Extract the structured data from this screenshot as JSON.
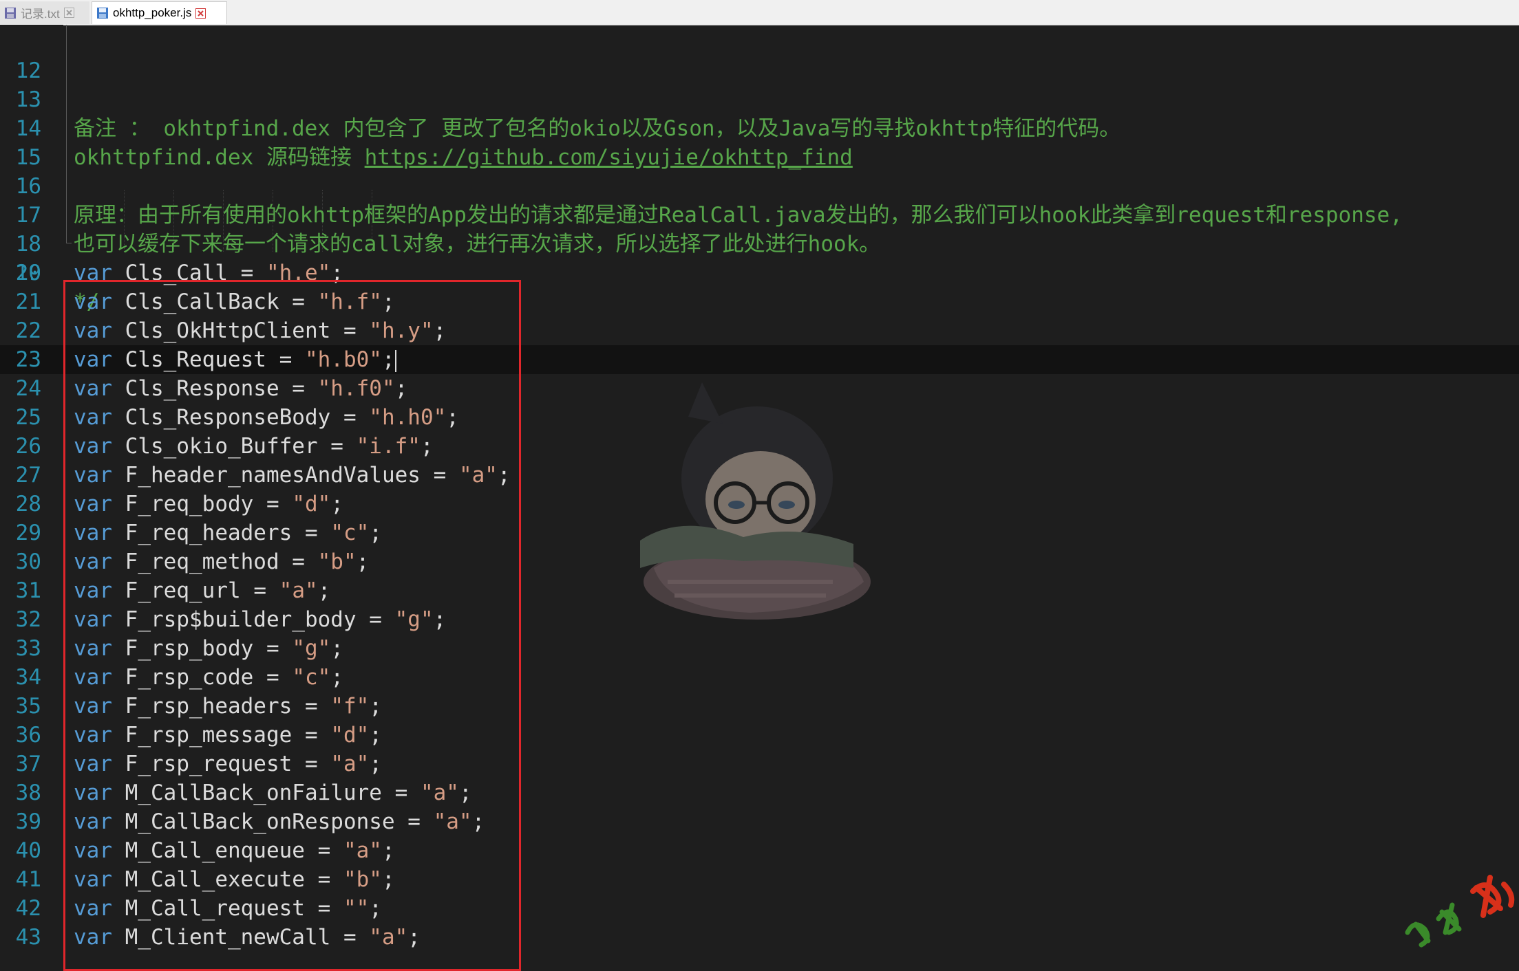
{
  "tabs": [
    {
      "label": "记录.txt",
      "active": false
    },
    {
      "label": "okhttp_poker.js",
      "active": true
    }
  ],
  "colors": {
    "comment": "#57a64a",
    "keyword": "#569cd6",
    "identifier": "#dcdcdc",
    "string": "#d69d85",
    "line_number": "#2b91af",
    "highlight_box": "#e0262b"
  },
  "comment_lines": [
    {
      "num": "12",
      "text": ""
    },
    {
      "num": "13",
      "text": "备注 ： okhtpfind.dex 内包含了 更改了包名的okio以及Gson，以及Java写的寻找okhttp特征的代码。"
    },
    {
      "num": "14",
      "text": "okhttpfind.dex 源码链接 ",
      "url": "https://github.com/siyujie/okhttp_find"
    },
    {
      "num": "15",
      "text": ""
    },
    {
      "num": "16",
      "text": "原理：由于所有使用的okhttp框架的App发出的请求都是通过RealCall.java发出的，那么我们可以hook此类拿到request和response,"
    },
    {
      "num": "17",
      "text": "也可以缓存下来每一个请求的call对象，进行再次请求，所以选择了此处进行hook。"
    },
    {
      "num": "18",
      "text": ""
    },
    {
      "num": "19",
      "text": "*/"
    }
  ],
  "code_lines": [
    {
      "num": "20",
      "kw": "var",
      "name": "Cls_Call",
      "op": " = ",
      "str": "\"h.e\"",
      "end": ";"
    },
    {
      "num": "21",
      "kw": "var",
      "name": "Cls_CallBack",
      "op": " = ",
      "str": "\"h.f\"",
      "end": ";"
    },
    {
      "num": "22",
      "kw": "var",
      "name": "Cls_OkHttpClient",
      "op": " = ",
      "str": "\"h.y\"",
      "end": ";"
    },
    {
      "num": "23",
      "kw": "var",
      "name": "Cls_Request",
      "op": " = ",
      "str": "\"h.b0\"",
      "end": ";",
      "current": true
    },
    {
      "num": "24",
      "kw": "var",
      "name": "Cls_Response",
      "op": " = ",
      "str": "\"h.f0\"",
      "end": ";"
    },
    {
      "num": "25",
      "kw": "var",
      "name": "Cls_ResponseBody",
      "op": " = ",
      "str": "\"h.h0\"",
      "end": ";"
    },
    {
      "num": "26",
      "kw": "var",
      "name": "Cls_okio_Buffer",
      "op": " = ",
      "str": "\"i.f\"",
      "end": ";"
    },
    {
      "num": "27",
      "kw": "var",
      "name": "F_header_namesAndValues",
      "op": " = ",
      "str": "\"a\"",
      "end": ";"
    },
    {
      "num": "28",
      "kw": "var",
      "name": "F_req_body",
      "op": " = ",
      "str": "\"d\"",
      "end": ";"
    },
    {
      "num": "29",
      "kw": "var",
      "name": "F_req_headers",
      "op": " = ",
      "str": "\"c\"",
      "end": ";"
    },
    {
      "num": "30",
      "kw": "var",
      "name": "F_req_method",
      "op": " = ",
      "str": "\"b\"",
      "end": ";"
    },
    {
      "num": "31",
      "kw": "var",
      "name": "F_req_url",
      "op": " = ",
      "str": "\"a\"",
      "end": ";"
    },
    {
      "num": "32",
      "kw": "var",
      "name": "F_rsp$builder_body",
      "op": " = ",
      "str": "\"g\"",
      "end": ";"
    },
    {
      "num": "33",
      "kw": "var",
      "name": "F_rsp_body",
      "op": " = ",
      "str": "\"g\"",
      "end": ";"
    },
    {
      "num": "34",
      "kw": "var",
      "name": "F_rsp_code",
      "op": " = ",
      "str": "\"c\"",
      "end": ";"
    },
    {
      "num": "35",
      "kw": "var",
      "name": "F_rsp_headers",
      "op": " = ",
      "str": "\"f\"",
      "end": ";"
    },
    {
      "num": "36",
      "kw": "var",
      "name": "F_rsp_message",
      "op": " = ",
      "str": "\"d\"",
      "end": ";"
    },
    {
      "num": "37",
      "kw": "var",
      "name": "F_rsp_request",
      "op": " = ",
      "str": "\"a\"",
      "end": ";"
    },
    {
      "num": "38",
      "kw": "var",
      "name": "M_CallBack_onFailure",
      "op": " = ",
      "str": "\"a\"",
      "end": ";"
    },
    {
      "num": "39",
      "kw": "var",
      "name": "M_CallBack_onResponse",
      "op": " = ",
      "str": "\"a\"",
      "end": ";"
    },
    {
      "num": "40",
      "kw": "var",
      "name": "M_Call_enqueue",
      "op": " = ",
      "str": "\"a\"",
      "end": ";"
    },
    {
      "num": "41",
      "kw": "var",
      "name": "M_Call_execute",
      "op": " = ",
      "str": "\"b\"",
      "end": ";"
    },
    {
      "num": "42",
      "kw": "var",
      "name": "M_Call_request",
      "op": " = ",
      "str": "\"\"",
      "end": ";"
    },
    {
      "num": "43",
      "kw": "var",
      "name": "M_Client_newCall",
      "op": " = ",
      "str": "\"a\"",
      "end": ";"
    }
  ]
}
